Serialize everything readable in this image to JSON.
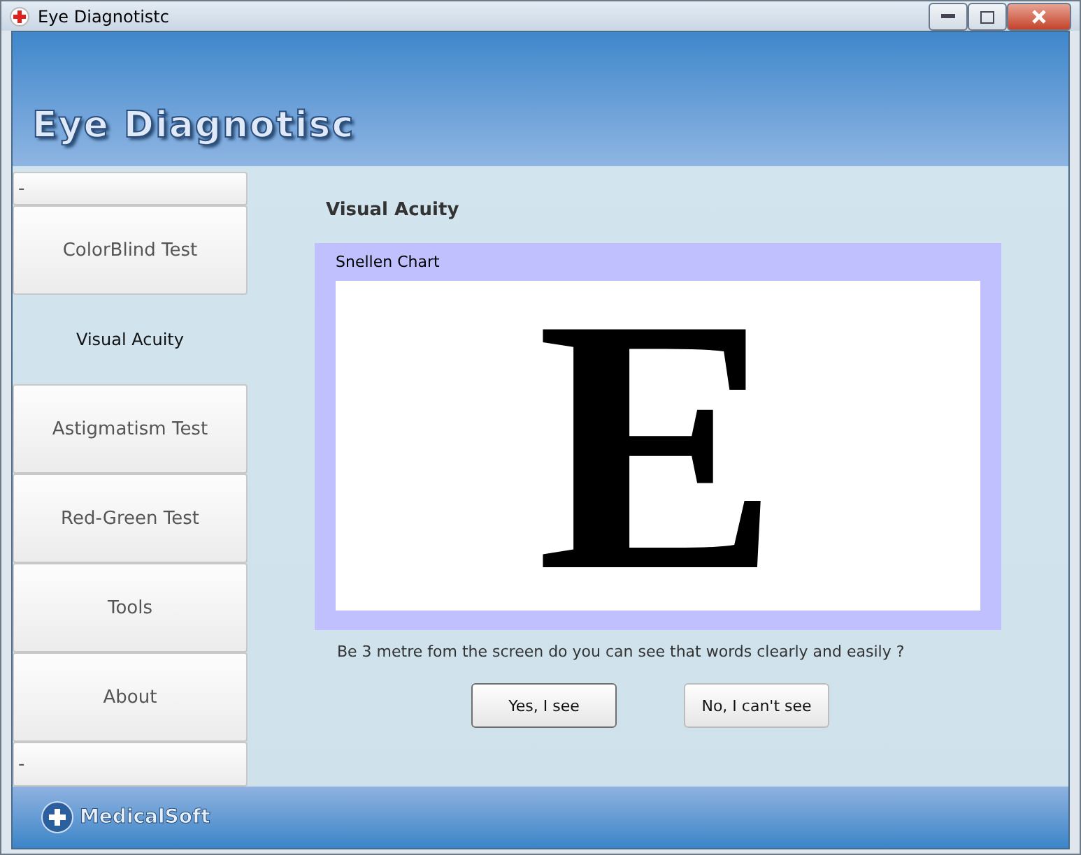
{
  "window": {
    "title": "Eye Diagnotistc"
  },
  "header": {
    "logo": "Eye Diagnotisc"
  },
  "sidebar": {
    "items": [
      {
        "label": "-",
        "kind": "spacer",
        "selected": false
      },
      {
        "label": "ColorBlind Test",
        "kind": "button",
        "selected": false
      },
      {
        "label": "Visual Acuity",
        "kind": "button",
        "selected": true
      },
      {
        "label": "Astigmatism Test",
        "kind": "button",
        "selected": false
      },
      {
        "label": "Red-Green Test",
        "kind": "button",
        "selected": false
      },
      {
        "label": "Tools",
        "kind": "button",
        "selected": false
      },
      {
        "label": "About",
        "kind": "button",
        "selected": false
      },
      {
        "label": "-",
        "kind": "spacer",
        "selected": false
      }
    ]
  },
  "content": {
    "heading": "Visual Acuity",
    "panel_title": "Snellen Chart",
    "chart_letter": "E",
    "question": "Be 3 metre fom the screen do you can see that words clearly and easily ?",
    "buttons": [
      "Yes, I see",
      "No, I can't see"
    ]
  },
  "footer": {
    "brand": "MedicalSoft"
  }
}
